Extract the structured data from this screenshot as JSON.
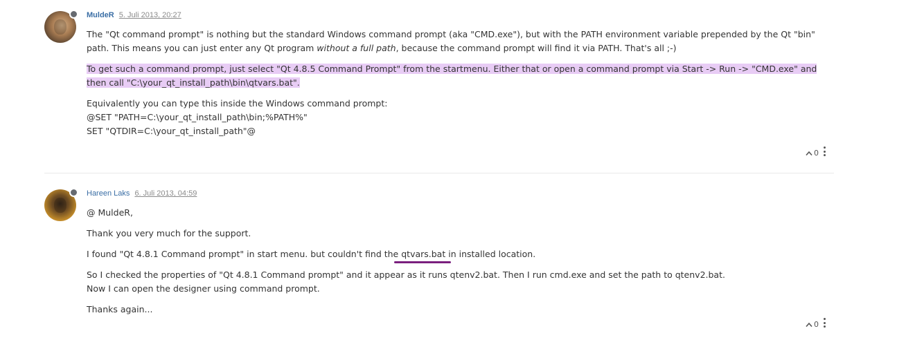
{
  "posts": [
    {
      "author": "MuldeR",
      "timestamp": "5. Juli 2013, 20:27",
      "paragraphs": {
        "p1_a": "The \"Qt command prompt\" is nothing but the standard Windows command prompt (aka \"CMD.exe\"), but with the PATH environment variable prepended by the Qt \"bin\" path. This means you can just enter any Qt program ",
        "p1_em": "without a full path",
        "p1_b": ", because the command prompt will find it via PATH. That's all ;-)",
        "p2": "To get such a command prompt, just select \"Qt 4.8.5 Command Prompt\" from the startmenu. Either that or open a command prompt via Start -> Run -> \"CMD.exe\" and then call \"C:\\your_qt_install_path\\bin\\qtvars.bat\".",
        "p3_l1": "Equivalently you can type this inside the Windows command prompt:",
        "p3_l2": "@SET \"PATH=C:\\your_qt_install_path\\bin;%PATH%\"",
        "p3_l3": "SET \"QTDIR=C:\\your_qt_install_path\"@"
      },
      "votes": "0"
    },
    {
      "author": "Hareen Laks",
      "timestamp": "6. Juli 2013, 04:59",
      "paragraphs": {
        "p1": "@ MuldeR,",
        "p2": "Thank you very much for the support.",
        "p3_a": "I found \"Qt 4.8.1 Command prompt\" in start menu. but couldn't find the ",
        "p3_u": "qtvars.bat",
        "p3_b": " in installed location.",
        "p4_l1": "So I checked the properties of \"Qt 4.8.1 Command prompt\" and it appear as it runs qtenv2.bat. Then I run cmd.exe and set the path to qtenv2.bat.",
        "p4_l2": "Now I can open the designer using command prompt.",
        "p5": "Thanks again..."
      },
      "votes": "0"
    }
  ],
  "icons": {
    "upvote": "chevron-up-icon",
    "menu": "more-vertical-icon",
    "status": "offline-status-icon"
  },
  "colors": {
    "author_link": "#3a6ea5",
    "highlight": "#e8ccf5",
    "annotation": "#7a1f7e"
  }
}
